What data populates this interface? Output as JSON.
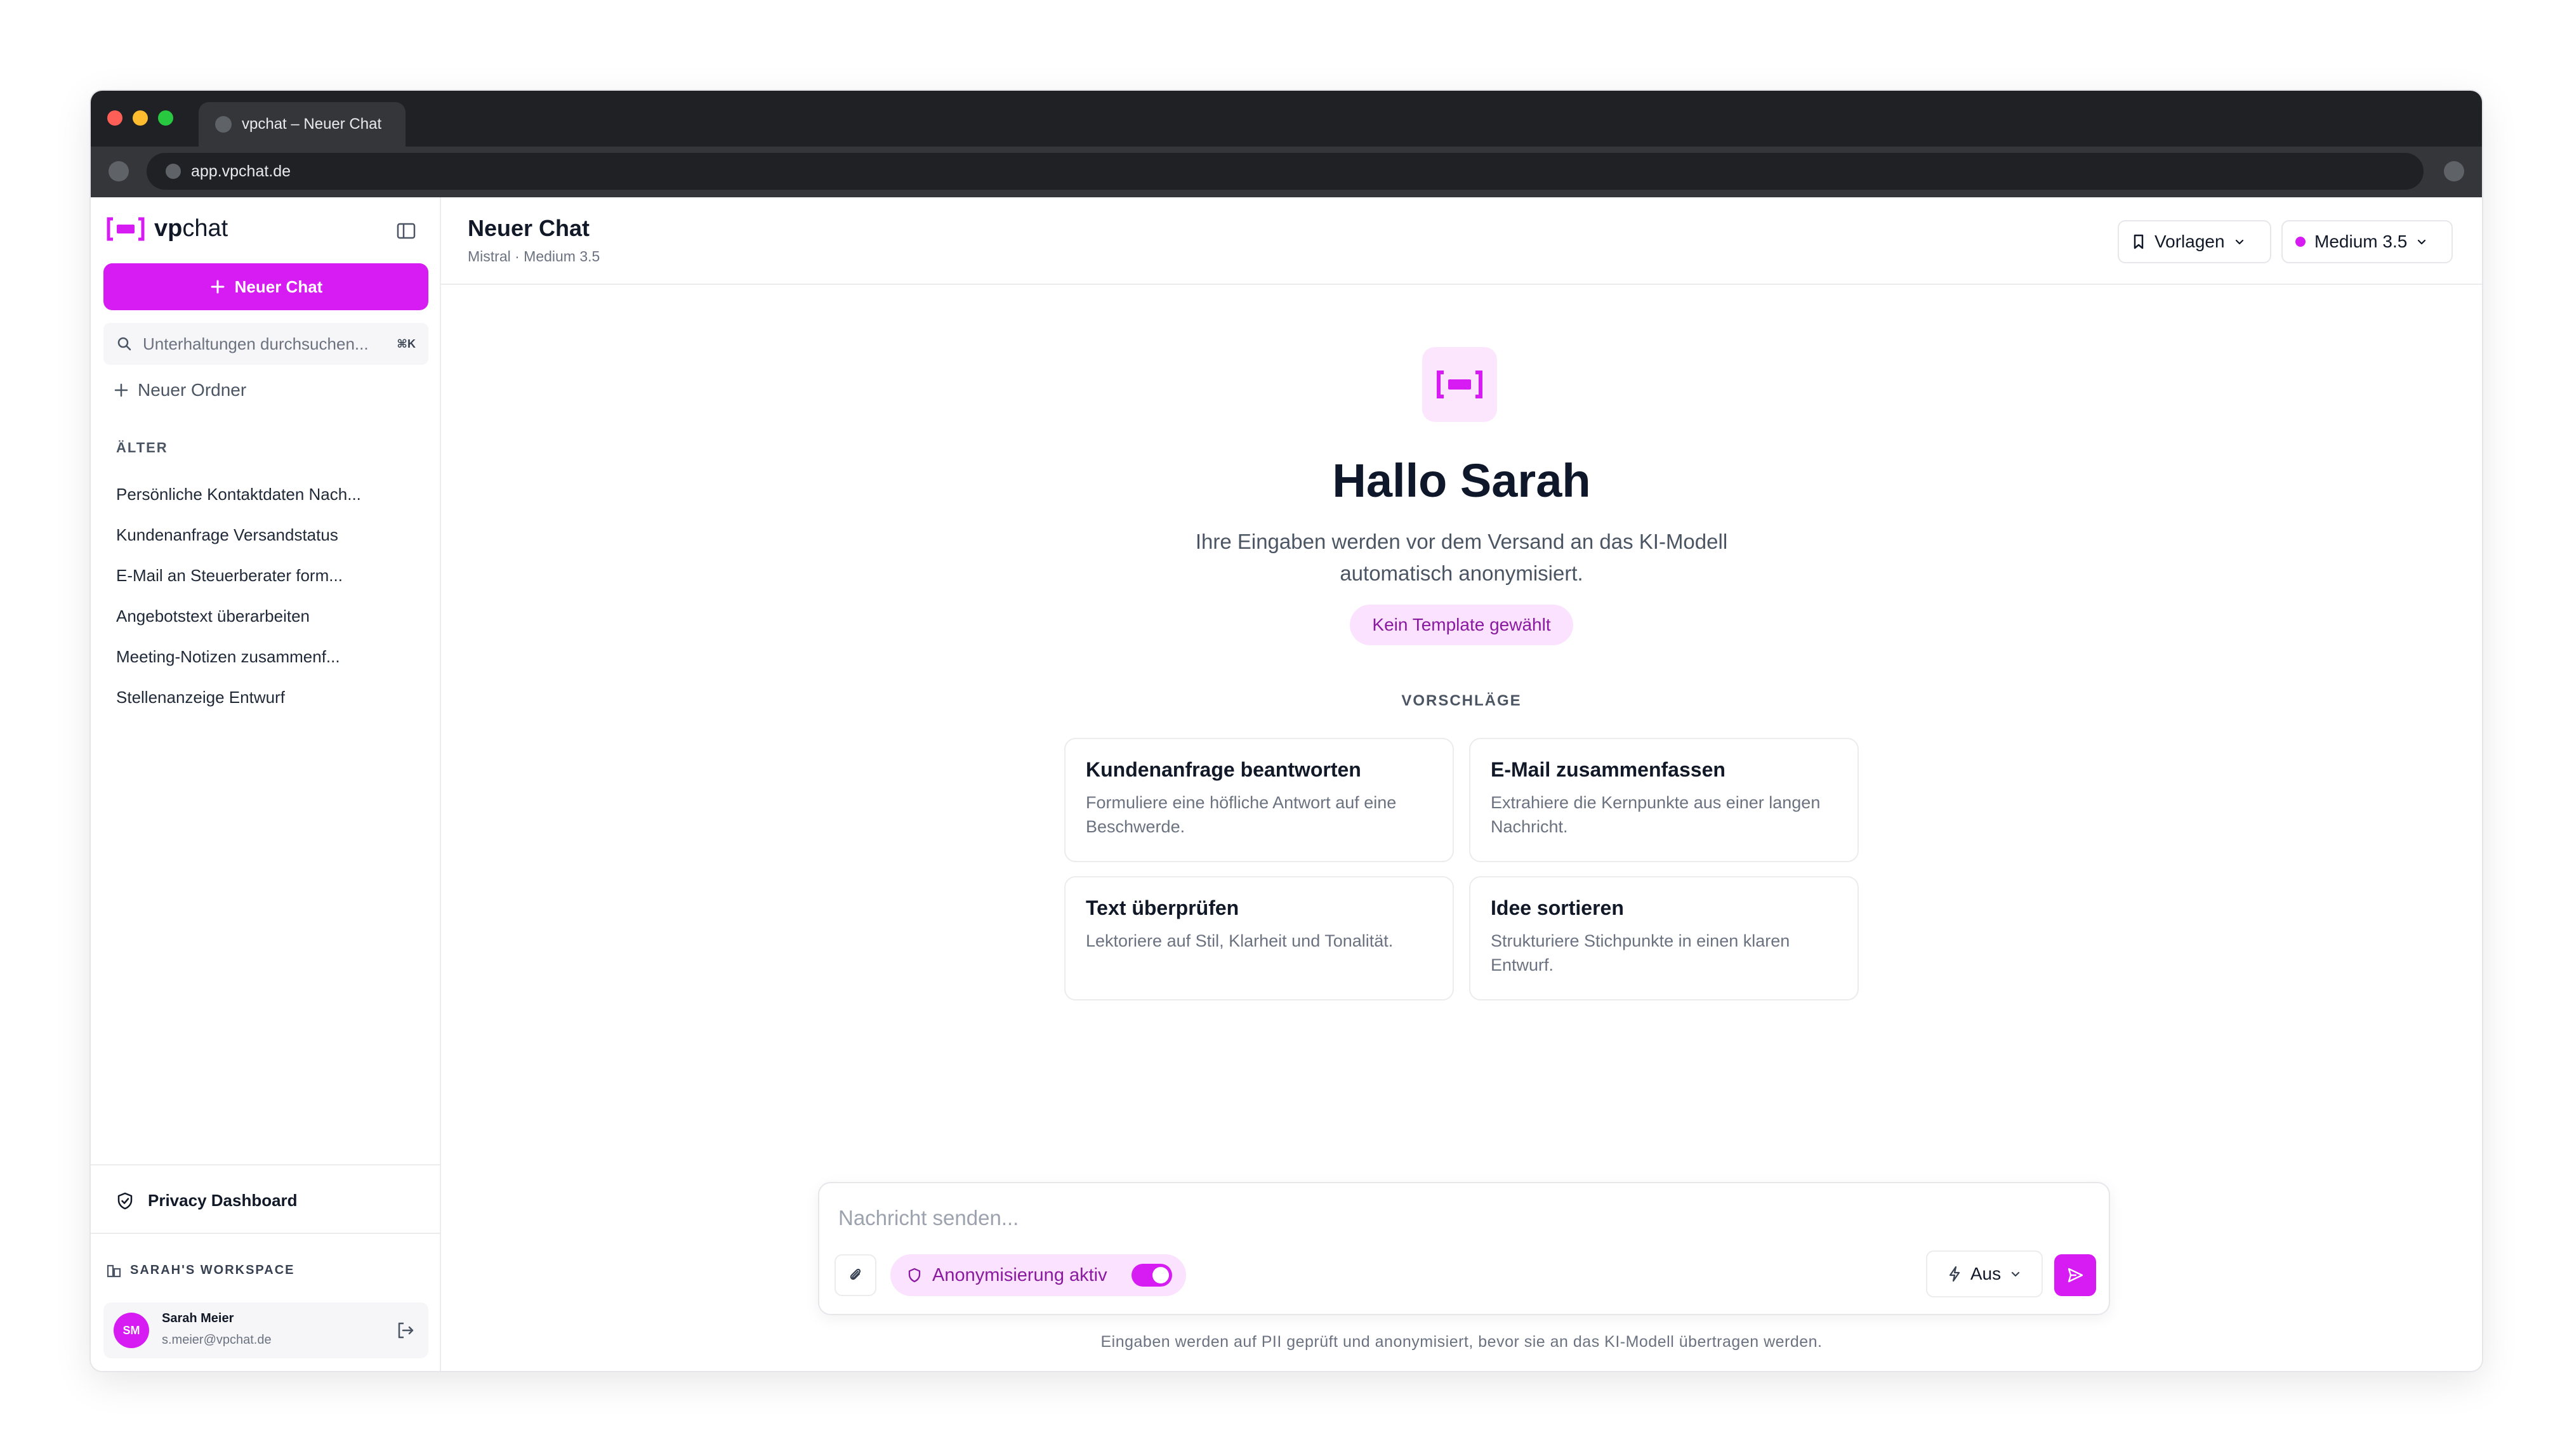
{
  "browser": {
    "tab_title": "vpchat – Neuer Chat",
    "url": "app.vpchat.de",
    "colors": {
      "close": "#ff5f57",
      "minimize": "#febc2e",
      "maximize": "#28c840"
    }
  },
  "sidebar": {
    "logo_prefix": "vp",
    "logo_suffix": "chat",
    "new_chat_label": "Neuer Chat",
    "search_placeholder": "Unterhaltungen durchsuchen...",
    "search_shortcut": "⌘K",
    "new_folder_label": "Neuer Ordner",
    "section_label": "ÄLTER",
    "conversations": [
      "Persönliche Kontaktdaten Nach...",
      "Kundenanfrage Versandstatus",
      "E-Mail an Steuerberater form...",
      "Angebotstext überarbeiten",
      "Meeting-Notizen zusammenf...",
      "Stellenanzeige Entwurf"
    ],
    "privacy_label": "Privacy Dashboard",
    "workspace_label": "SARAH'S WORKSPACE",
    "user": {
      "initials": "SM",
      "name": "Sarah Meier",
      "email": "s.meier@vpchat.de"
    }
  },
  "header": {
    "title": "Neuer Chat",
    "subtitle": "Mistral · Medium 3.5",
    "templates_label": "Vorlagen",
    "model_label": "Medium 3.5"
  },
  "hero": {
    "title": "Hallo Sarah",
    "subtitle": "Ihre Eingaben werden vor dem Versand an das KI-Modell automatisch anonymisiert.",
    "template_pill": "Kein Template gewählt",
    "suggestions_label": "VORSCHLÄGE"
  },
  "suggestions": [
    {
      "title": "Kundenanfrage beantworten",
      "desc": "Formuliere eine höfliche Antwort auf eine Beschwerde."
    },
    {
      "title": "E-Mail zusammenfassen",
      "desc": "Extrahiere die Kernpunkte aus einer langen Nachricht."
    },
    {
      "title": "Text überprüfen",
      "desc": "Lektoriere auf Stil, Klarheit und Tonalität."
    },
    {
      "title": "Idee sortieren",
      "desc": "Strukturiere Stichpunkte in einen klaren Entwurf."
    }
  ],
  "composer": {
    "placeholder": "Nachricht senden...",
    "anonymization_label": "Anonymisierung aktiv",
    "anonymization_on": true,
    "mode_label": "Aus",
    "footnote": "Eingaben werden auf PII geprüft und anonymisiert, bevor sie an das KI-Modell übertragen werden."
  },
  "theme": {
    "accent": "#d61cf2",
    "accent_soft": "#fbe2fe"
  }
}
